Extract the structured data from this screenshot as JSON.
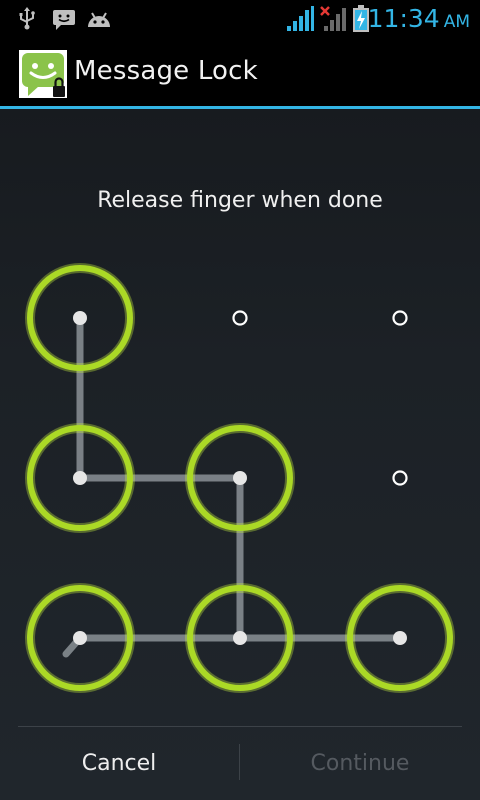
{
  "status_bar": {
    "time": "11:34",
    "ampm": "AM",
    "icons": [
      "usb-icon",
      "message-notification-icon",
      "android-debug-icon",
      "wifi-signal-icon",
      "no-signal-icon",
      "battery-charging-icon"
    ],
    "accent_color": "#33b5e5"
  },
  "action_bar": {
    "title": "Message Lock",
    "icon": "message-lock-app-icon"
  },
  "pattern": {
    "header": "Release finger when done",
    "grid_size": 3,
    "selected_dots": [
      [
        0,
        0
      ],
      [
        1,
        0
      ],
      [
        1,
        1
      ],
      [
        2,
        1
      ],
      [
        2,
        2
      ],
      [
        2,
        0
      ]
    ],
    "path_order": [
      [
        0,
        0
      ],
      [
        1,
        0
      ],
      [
        1,
        1
      ],
      [
        2,
        1
      ],
      [
        2,
        2
      ]
    ],
    "ring_color": "#9ccc1a"
  },
  "footer": {
    "cancel_label": "Cancel",
    "continue_label": "Continue"
  }
}
